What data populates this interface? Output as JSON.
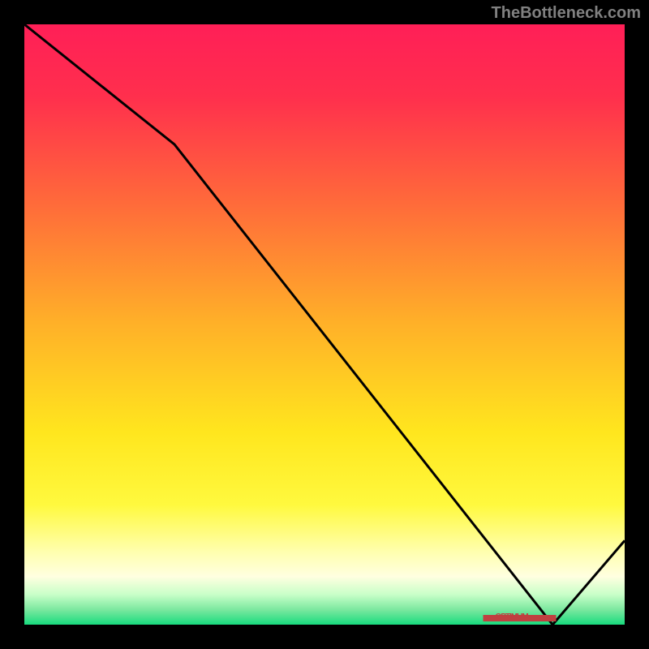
{
  "watermark": "TheBottleneck.com",
  "chart_data": {
    "type": "line",
    "x": [
      0,
      0.25,
      0.88,
      1.0
    ],
    "y": [
      100,
      80,
      0,
      14
    ],
    "xlim": [
      0,
      1
    ],
    "ylim": [
      0,
      100
    ],
    "title": "",
    "xlabel": "",
    "ylabel": "",
    "marker": {
      "x": 0.825,
      "label": "OPTIMUM"
    },
    "gradient_stops": [
      {
        "pos": 0.0,
        "color": "#ff1f57"
      },
      {
        "pos": 0.12,
        "color": "#ff2f4d"
      },
      {
        "pos": 0.3,
        "color": "#ff6b3a"
      },
      {
        "pos": 0.5,
        "color": "#ffb128"
      },
      {
        "pos": 0.68,
        "color": "#ffe61e"
      },
      {
        "pos": 0.8,
        "color": "#fff93e"
      },
      {
        "pos": 0.88,
        "color": "#ffffb0"
      },
      {
        "pos": 0.92,
        "color": "#ffffe0"
      },
      {
        "pos": 0.95,
        "color": "#c8ffc8"
      },
      {
        "pos": 0.975,
        "color": "#7be89f"
      },
      {
        "pos": 1.0,
        "color": "#18db7e"
      }
    ]
  }
}
